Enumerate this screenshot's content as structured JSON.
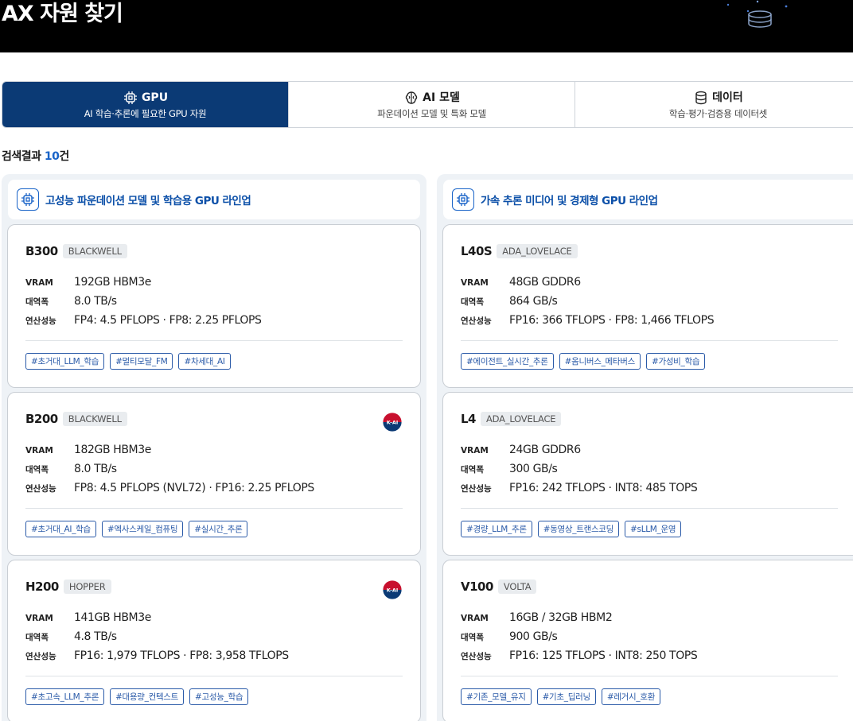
{
  "page": {
    "title": "AX 자원 찾기"
  },
  "tabs": [
    {
      "label": "GPU",
      "subtitle": "AI 학습·추론에 필요한 GPU 자원",
      "icon": "chip-icon",
      "active": true
    },
    {
      "label": "AI 모델",
      "subtitle": "파운데이션 모델 및 특화 모델",
      "icon": "brain-icon",
      "active": false
    },
    {
      "label": "데이터",
      "subtitle": "학습·평가·검증용 데이터셋",
      "icon": "database-icon",
      "active": false
    }
  ],
  "result": {
    "prefix": "검색결과",
    "count": "10",
    "suffix": "건"
  },
  "columns": [
    {
      "title": "고성능 파운데이션 모델 및 학습용 GPU 라인업",
      "cards": [
        {
          "model": "B300",
          "arch": "BLACKWELL",
          "has_badge": false,
          "vram": "192GB HBM3e",
          "bandwidth": "8.0 TB/s",
          "perf": "FP4: 4.5 PFLOPS · FP8: 2.25 PFLOPS",
          "tags": [
            "#초거대_LLM_학습",
            "#멀티모달_FM",
            "#차세대_AI"
          ]
        },
        {
          "model": "B200",
          "arch": "BLACKWELL",
          "has_badge": true,
          "vram": "182GB HBM3e",
          "bandwidth": "8.0 TB/s",
          "perf": "FP8: 4.5 PFLOPS (NVL72) · FP16: 2.25 PFLOPS",
          "tags": [
            "#초거대_AI_학습",
            "#엑사스케일_컴퓨팅",
            "#실시간_추론"
          ]
        },
        {
          "model": "H200",
          "arch": "HOPPER",
          "has_badge": true,
          "vram": "141GB HBM3e",
          "bandwidth": "4.8 TB/s",
          "perf": "FP16: 1,979 TFLOPS · FP8: 3,958 TFLOPS",
          "tags": [
            "#초고속_LLM_추론",
            "#대용량_컨텍스트",
            "#고성능_학습"
          ]
        }
      ]
    },
    {
      "title": "가속 추론 미디어 및 경제형 GPU 라인업",
      "cards": [
        {
          "model": "L40S",
          "arch": "ADA_LOVELACE",
          "has_badge": false,
          "vram": "48GB GDDR6",
          "bandwidth": "864 GB/s",
          "perf": "FP16: 366 TFLOPS · FP8: 1,466 TFLOPS",
          "tags": [
            "#에이전트_실시간_추론",
            "#옴니버스_메타버스",
            "#가성비_학습"
          ]
        },
        {
          "model": "L4",
          "arch": "ADA_LOVELACE",
          "has_badge": false,
          "vram": "24GB GDDR6",
          "bandwidth": "300 GB/s",
          "perf": "FP16: 242 TFLOPS · INT8: 485 TOPS",
          "tags": [
            "#경량_LLM_추론",
            "#동영상_트랜스코딩",
            "#sLLM_운영"
          ]
        },
        {
          "model": "V100",
          "arch": "VOLTA",
          "has_badge": false,
          "vram": "16GB / 32GB HBM2",
          "bandwidth": "900 GB/s",
          "perf": "FP16: 125 TFLOPS · INT8: 250 TOPS",
          "tags": [
            "#기존_모델_유지",
            "#기초_딥러닝",
            "#레거시_호환"
          ]
        }
      ]
    }
  ],
  "labels": {
    "vram": "VRAM",
    "bandwidth": "대역폭",
    "perf": "연산성능"
  },
  "badge_text": "K-AI",
  "colors": {
    "primary": "#0b3a75",
    "accent": "#1a64c8",
    "tag": "#2a5aa8"
  }
}
